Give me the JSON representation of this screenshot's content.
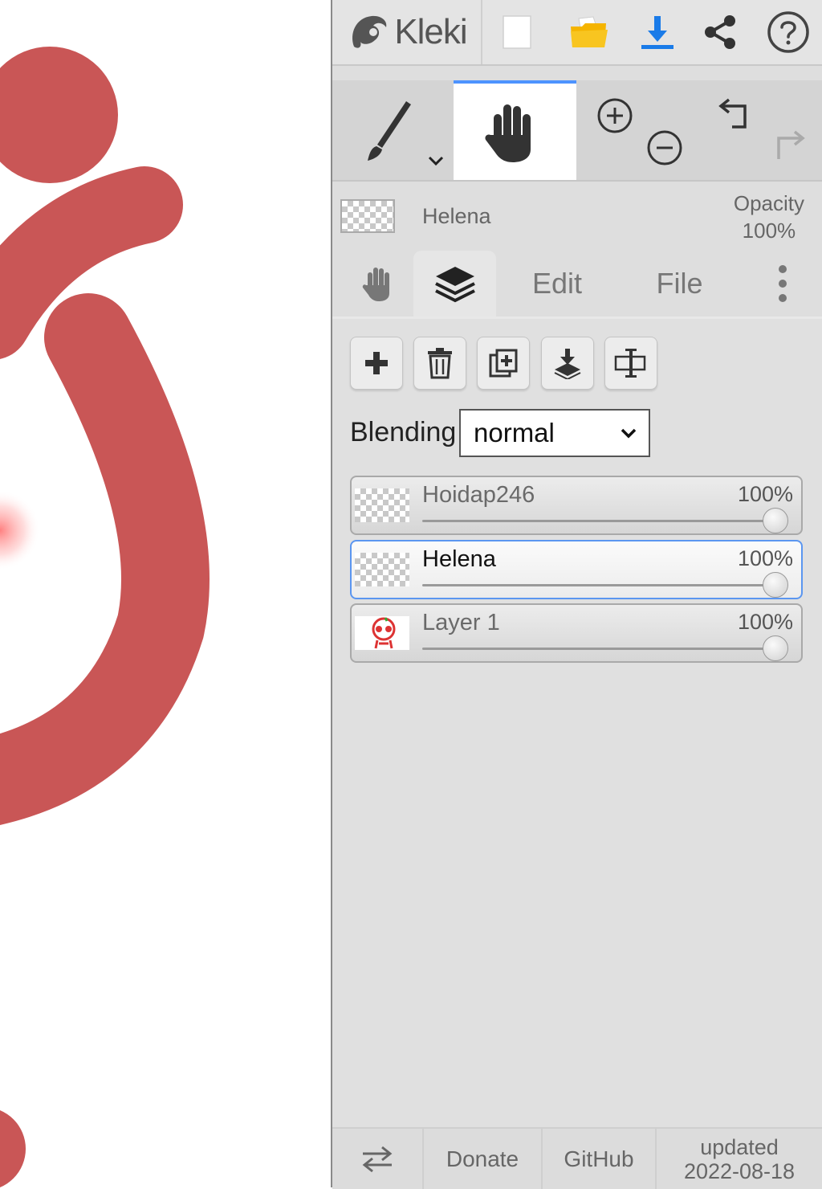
{
  "app": {
    "name": "Kleki"
  },
  "toolbar": {
    "buttons": [
      {
        "name": "new-image",
        "icon": "blank-page-icon"
      },
      {
        "name": "open-image",
        "icon": "folder-icon"
      },
      {
        "name": "save-image",
        "icon": "download-icon"
      },
      {
        "name": "share",
        "icon": "share-icon"
      },
      {
        "name": "help",
        "icon": "question-icon"
      }
    ]
  },
  "tools": {
    "active": "hand",
    "items": [
      "brush",
      "hand",
      "zoom-in",
      "zoom-out",
      "undo",
      "redo"
    ]
  },
  "layer_info": {
    "name": "Helena",
    "opacity_label": "Opacity",
    "opacity_value": "100%"
  },
  "tabs": {
    "active": "layers",
    "edit": "Edit",
    "file": "File"
  },
  "layers_panel": {
    "blending_label": "Blending",
    "blending_value": "normal",
    "layers": [
      {
        "name": "Hoidap246",
        "opacity": "100%",
        "opacity_fraction": 1.0,
        "active": false
      },
      {
        "name": "Helena",
        "opacity": "100%",
        "opacity_fraction": 1.0,
        "active": true
      },
      {
        "name": "Layer 1",
        "opacity": "100%",
        "opacity_fraction": 1.0,
        "active": false
      }
    ]
  },
  "footer": {
    "donate": "Donate",
    "github": "GitHub",
    "updated_label": "updated",
    "updated_date": "2022-08-18"
  },
  "colors": {
    "canvas_stroke": "#c95656",
    "accent_blue": "#1a7be8",
    "folder_yellow": "#f5b400",
    "active_border": "#5b96f0"
  }
}
